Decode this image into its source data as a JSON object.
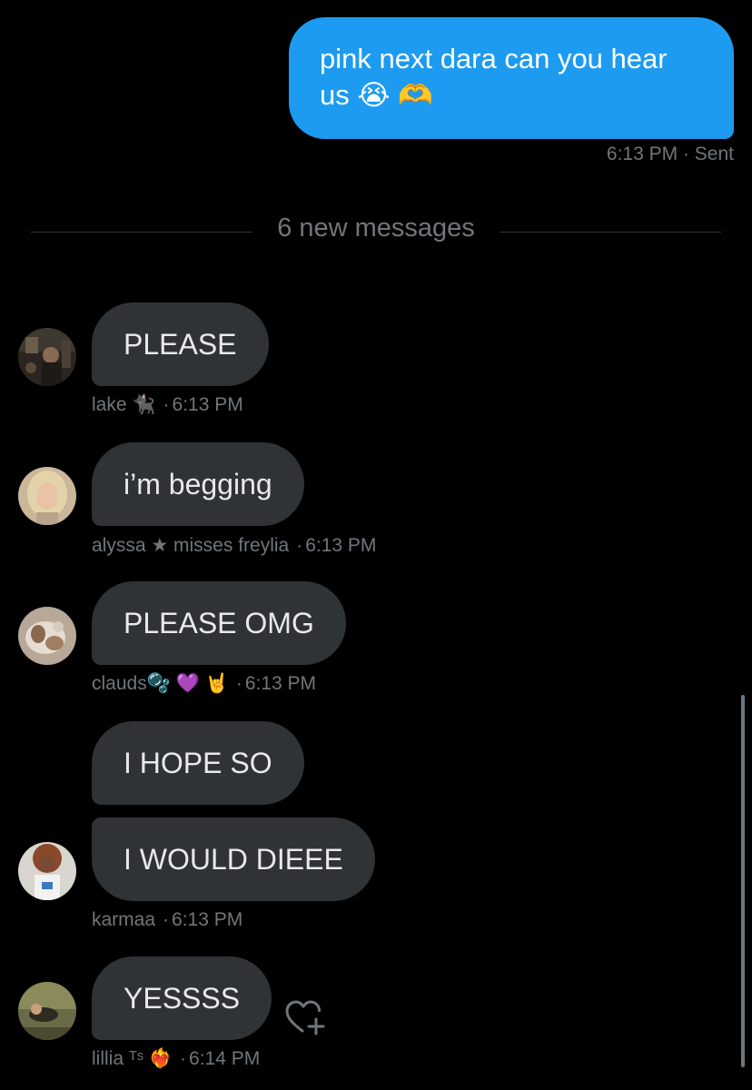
{
  "sent_message": {
    "text": "pink next dara can you hear us 😭 🫶",
    "time": "6:13 PM",
    "status": "Sent",
    "accent_color": "#1d9bf0"
  },
  "divider": {
    "label": "6 new messages"
  },
  "messages": [
    {
      "author": "lake 🐈‍⬛",
      "text": "PLEASE",
      "time": "6:13 PM",
      "avatar": "user-avatar"
    },
    {
      "author": "alyssa ★ misses freylia",
      "text": "i’m begging",
      "time": "6:13 PM",
      "avatar": "user-avatar"
    },
    {
      "author": "clauds🫧 💜 🤘",
      "text": "PLEASE OMG",
      "time": "6:13 PM",
      "avatar": "user-avatar"
    },
    {
      "author": "karmaa",
      "text": "I HOPE SO",
      "time": "",
      "avatar": ""
    },
    {
      "author": "karmaa",
      "text": "I WOULD DIEEE",
      "time": "6:13 PM",
      "avatar": "user-avatar"
    },
    {
      "author": "lillia ᵀˢ ❤️‍🔥",
      "text": "YESSSS",
      "time": "6:14 PM",
      "avatar": "user-avatar"
    }
  ],
  "icons": {
    "react": "heart-plus-icon"
  }
}
